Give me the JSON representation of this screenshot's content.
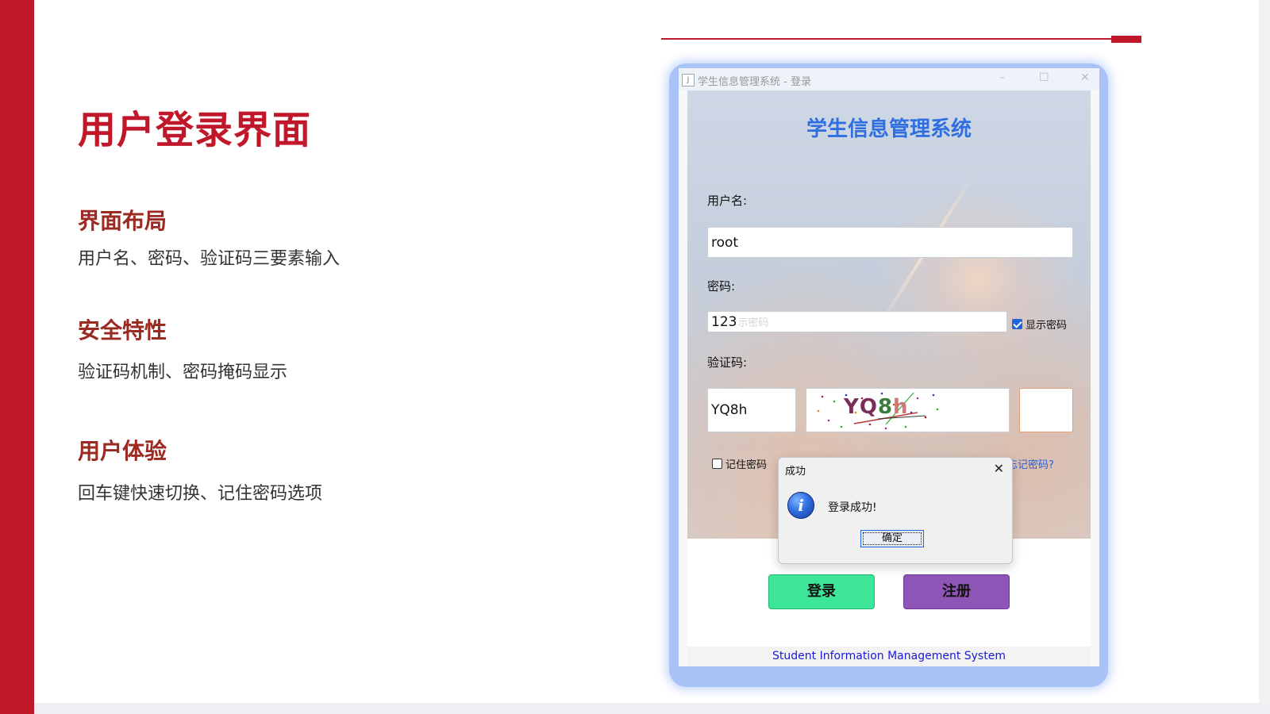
{
  "slide": {
    "title": "用户登录界面",
    "sections": [
      {
        "heading": "界面布局",
        "text": "用户名、密码、验证码三要素输入"
      },
      {
        "heading": "安全特性",
        "text": "验证码机制、密码掩码显示"
      },
      {
        "heading": "用户体验",
        "text": "回车键快速切换、记住密码选项"
      }
    ],
    "accent_color": "#c0182a",
    "heading_color": "#9a2a22"
  },
  "window": {
    "title": "学生信息管理系统 - 登录",
    "controls": {
      "minimize": "–",
      "maximize": "☐",
      "close": "✕"
    },
    "app_title": "学生信息管理系统",
    "username": {
      "label": "用户名:",
      "value": "root"
    },
    "password": {
      "label": "密码:",
      "value": "123",
      "ghost": "示密码"
    },
    "show_password": {
      "label": "显示密码",
      "checked": true
    },
    "captcha": {
      "label": "验证码:",
      "value": "YQ8h",
      "image_text": "YQ8h"
    },
    "remember": {
      "label": "记住密码",
      "checked": false
    },
    "forgot_link": "忘记密码?",
    "login_button": "登录",
    "register_button": "注册",
    "footer": "Student Information Management System",
    "colors": {
      "title": "#2f6fe0",
      "login": "#3ee699",
      "register": "#8f55b6",
      "footer_text": "#1a1ad6"
    }
  },
  "dialog": {
    "title": "成功",
    "message": "登录成功!",
    "ok_button": "确定",
    "icon": "info-icon"
  }
}
